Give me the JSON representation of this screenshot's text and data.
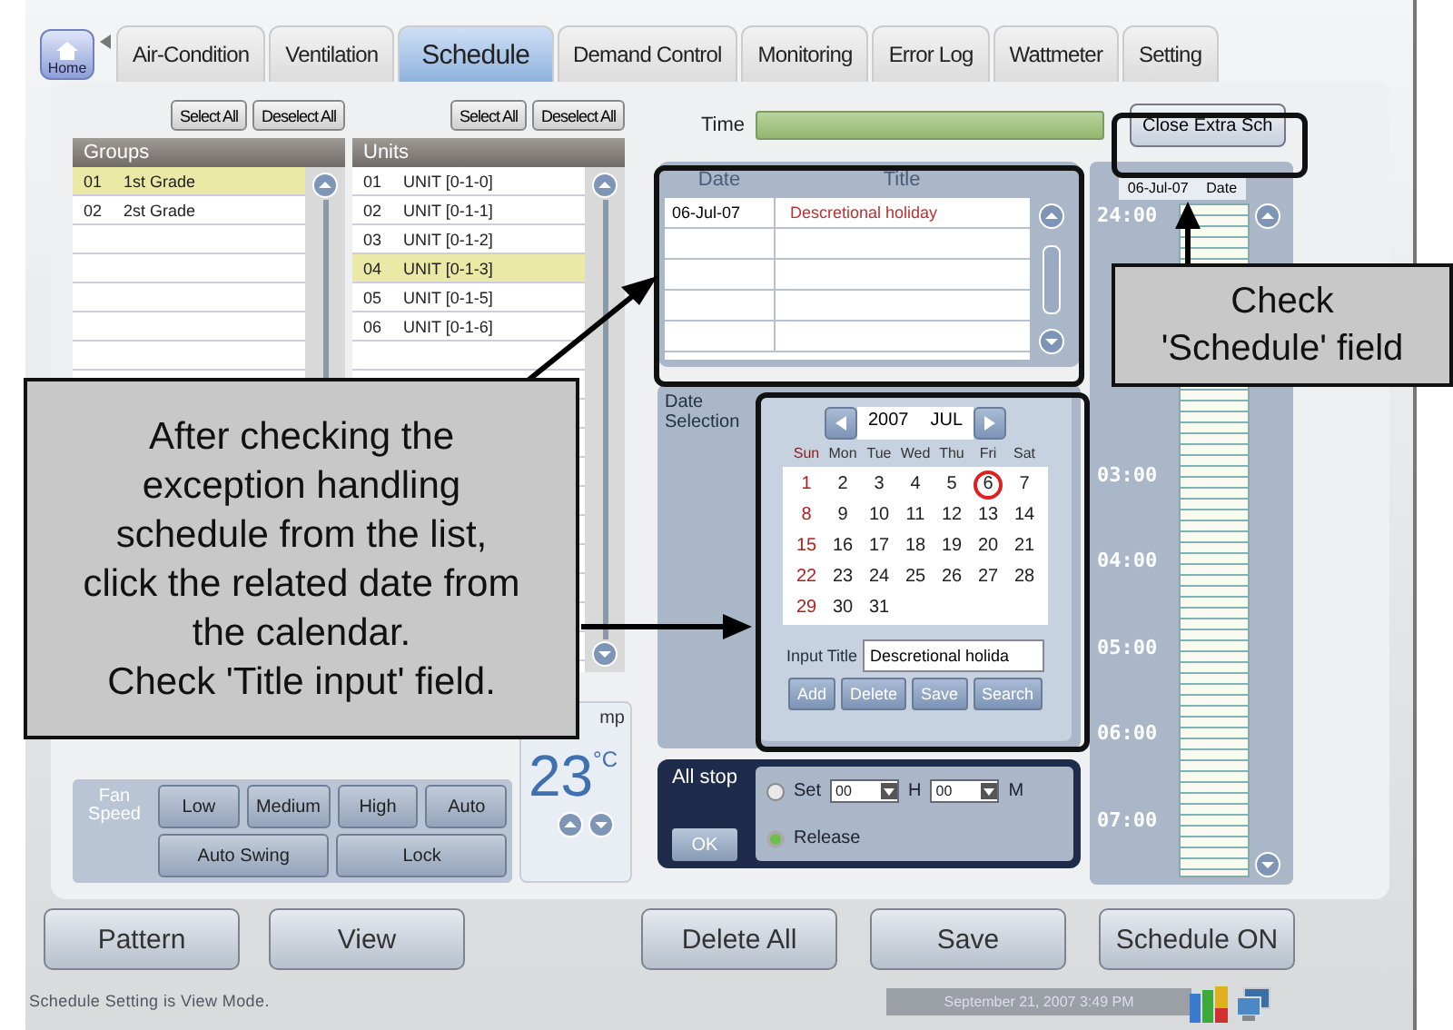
{
  "tabs": [
    {
      "label": "Home",
      "kind": "home",
      "selected": false
    },
    {
      "label": "Air-Condition",
      "kind": "tab",
      "selected": false
    },
    {
      "label": "Ventilation",
      "kind": "tab",
      "selected": false
    },
    {
      "label": "Schedule",
      "kind": "tab",
      "selected": true
    },
    {
      "label": "Demand Control",
      "kind": "tab",
      "selected": false
    },
    {
      "label": "Monitoring",
      "kind": "tab",
      "selected": false
    },
    {
      "label": "Error Log",
      "kind": "tab",
      "selected": false
    },
    {
      "label": "Wattmeter",
      "kind": "tab",
      "selected": false
    },
    {
      "label": "Setting",
      "kind": "tab",
      "selected": false
    }
  ],
  "groups": {
    "select_all": "Select All",
    "deselect_all": "Deselect All",
    "title": "Groups",
    "rows": [
      {
        "num": "01",
        "name": "1st Grade",
        "selected": true
      },
      {
        "num": "02",
        "name": "2st Grade",
        "selected": false
      }
    ]
  },
  "units": {
    "select_all": "Select All",
    "deselect_all": "Deselect All",
    "title": "Units",
    "rows": [
      {
        "num": "01",
        "name": "UNIT [0-1-0]",
        "selected": false
      },
      {
        "num": "02",
        "name": "UNIT [0-1-1]",
        "selected": false
      },
      {
        "num": "03",
        "name": "UNIT [0-1-2]",
        "selected": false
      },
      {
        "num": "04",
        "name": "UNIT [0-1-3]",
        "selected": true
      },
      {
        "num": "05",
        "name": "UNIT [0-1-5]",
        "selected": false
      },
      {
        "num": "06",
        "name": "UNIT [0-1-6]",
        "selected": false
      }
    ]
  },
  "fan": {
    "label": "Fan Speed",
    "speeds": [
      "Low",
      "Medium",
      "High",
      "Auto"
    ],
    "extras": [
      "Auto Swing",
      "Lock"
    ]
  },
  "temp": {
    "label": "mp",
    "value": "23",
    "unit": "°C"
  },
  "time_label": "Time",
  "close_button": "Close Extra Sch",
  "schedule_list": {
    "columns": [
      "Date",
      "Title"
    ],
    "rows": [
      {
        "date": "06-Jul-07",
        "title": "Descretional holiday"
      }
    ]
  },
  "date_selection": {
    "label": "Date Selection",
    "year": "2007",
    "month": "JUL",
    "weekdays": [
      "Sun",
      "Mon",
      "Tue",
      "Wed",
      "Thu",
      "Fri",
      "Sat"
    ],
    "days": [
      {
        "d": "1",
        "selected": false
      },
      {
        "d": "2",
        "selected": false
      },
      {
        "d": "3",
        "selected": false
      },
      {
        "d": "4",
        "selected": false
      },
      {
        "d": "5",
        "selected": false
      },
      {
        "d": "6",
        "selected": true
      },
      {
        "d": "7",
        "selected": false
      },
      {
        "d": "8",
        "selected": false
      },
      {
        "d": "9",
        "selected": false
      },
      {
        "d": "10",
        "selected": false
      },
      {
        "d": "11",
        "selected": false
      },
      {
        "d": "12",
        "selected": false
      },
      {
        "d": "13",
        "selected": false
      },
      {
        "d": "14",
        "selected": false
      },
      {
        "d": "15",
        "selected": false
      },
      {
        "d": "16",
        "selected": false
      },
      {
        "d": "17",
        "selected": false
      },
      {
        "d": "18",
        "selected": false
      },
      {
        "d": "19",
        "selected": false
      },
      {
        "d": "20",
        "selected": false
      },
      {
        "d": "21",
        "selected": false
      },
      {
        "d": "22",
        "selected": false
      },
      {
        "d": "23",
        "selected": false
      },
      {
        "d": "24",
        "selected": false
      },
      {
        "d": "25",
        "selected": false
      },
      {
        "d": "26",
        "selected": false
      },
      {
        "d": "27",
        "selected": false
      },
      {
        "d": "28",
        "selected": false
      },
      {
        "d": "29",
        "selected": false
      },
      {
        "d": "30",
        "selected": false
      },
      {
        "d": "31",
        "selected": false
      }
    ],
    "input_label": "Input Title",
    "input_value": "Descretional holida",
    "buttons": [
      "Add",
      "Delete",
      "Save",
      "Search"
    ]
  },
  "all_stop": {
    "label": "All stop",
    "ok": "OK",
    "options": [
      {
        "label": "Set",
        "selected": false
      },
      {
        "label": "Release",
        "selected": true
      }
    ],
    "hour": "00",
    "hour_unit": "H",
    "minute": "00",
    "minute_unit": "M"
  },
  "timeline": {
    "date": "06-Jul-07",
    "date_label": "Date",
    "hours": [
      "24:00",
      "03:00",
      "04:00",
      "05:00",
      "06:00",
      "07:00"
    ]
  },
  "bottom_buttons": [
    "Pattern",
    "View",
    "Delete All",
    "Save",
    "Schedule ON"
  ],
  "status": {
    "message": "Schedule Setting is View Mode.",
    "datetime": "September 21, 2007 3:49 PM"
  },
  "callouts": [
    {
      "lines": [
        "After checking the",
        "exception handling",
        "schedule from the list,",
        "click the related date from",
        "the calendar.",
        "Check 'Title input' field."
      ]
    },
    {
      "lines": [
        "Check",
        "'Schedule'  field"
      ]
    }
  ]
}
